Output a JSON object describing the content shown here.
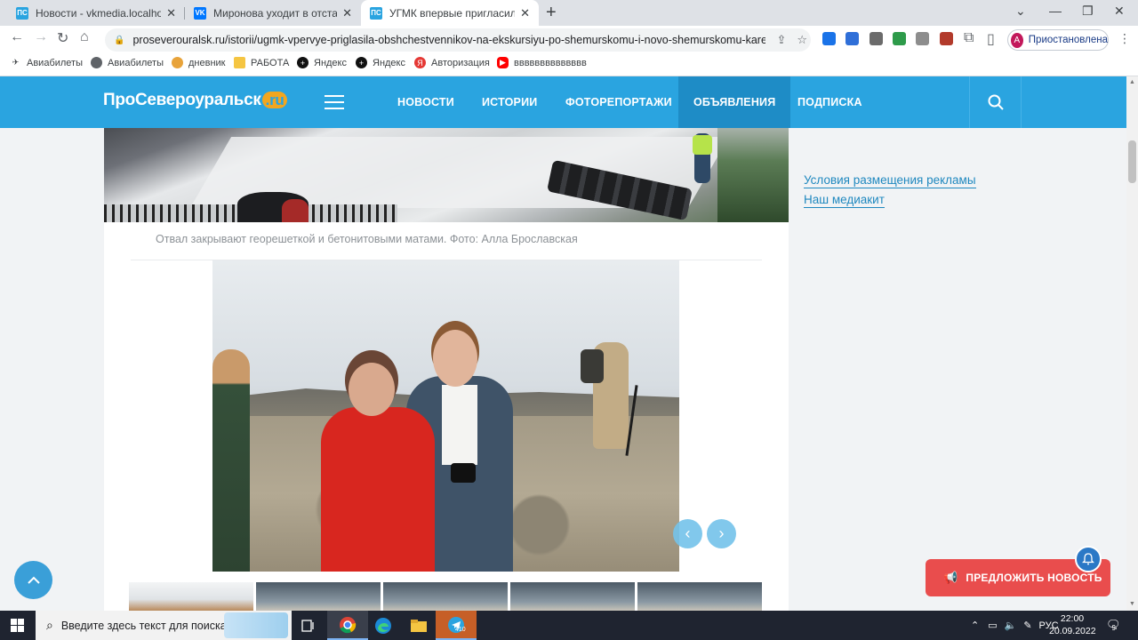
{
  "browser": {
    "tabs": [
      {
        "title": "Новости - vkmedia.localhost",
        "favicon": "ПС",
        "favicon_color": "#2aa4e0",
        "active": false
      },
      {
        "title": "Миронова уходит в отставку Се",
        "favicon": "VK",
        "favicon_color": "#0077ff",
        "active": false
      },
      {
        "title": "УГМК впервые пригласила общ",
        "favicon": "ПС",
        "favicon_color": "#2aa4e0",
        "active": true
      }
    ],
    "url": "proseverouralsk.ru/istorii/ugmk-vpervye-priglasila-obshchestvennikov-na-ekskursiyu-po-shemurskomu-i-novo-shemurskomu-kareram-...",
    "profile_initial": "A",
    "profile_label": "Приостановлена",
    "bookmarks": [
      {
        "label": "Авиабилеты",
        "icon": "plane-icon"
      },
      {
        "label": "Авиабилеты",
        "icon": "globe-icon"
      },
      {
        "label": "дневник",
        "icon": "diary-icon"
      },
      {
        "label": "РАБОТА",
        "icon": "folder-icon"
      },
      {
        "label": "Яндекс",
        "icon": "plus-circle-icon"
      },
      {
        "label": "Яндекс",
        "icon": "plus-circle-icon"
      },
      {
        "label": "Авторизация",
        "icon": "yandex-icon"
      },
      {
        "label": "вввввввввввввв",
        "icon": "youtube-icon"
      }
    ]
  },
  "site": {
    "logo_main": "ПроСевероуральск",
    "logo_suffix": ".ru",
    "nav": [
      "НОВОСТИ",
      "ИСТОРИИ",
      "ФОТОРЕПОРТАЖИ",
      "ОБЪЯВЛЕНИЯ",
      "ПОДПИСКА"
    ],
    "active_nav": "ОБЪЯВЛЕНИЯ",
    "accent_color": "#2aa4e0"
  },
  "article": {
    "caption": "Отвал закрывают георешеткой и бетонитовыми матами. Фото: Алла Брославская",
    "slider_prev": "‹",
    "slider_next": "›"
  },
  "sidebar": {
    "links": [
      "Условия размещения рекламы",
      "Наш медиакит"
    ]
  },
  "floating": {
    "suggest_label": "ПРЕДЛОЖИТЬ НОВОСТЬ"
  },
  "taskbar": {
    "search_placeholder": "Введите здесь текст для поиска",
    "telegram_badge": "410",
    "lang": "РУС",
    "time": "22:00",
    "date": "20.09.2022",
    "notifications": "9"
  }
}
